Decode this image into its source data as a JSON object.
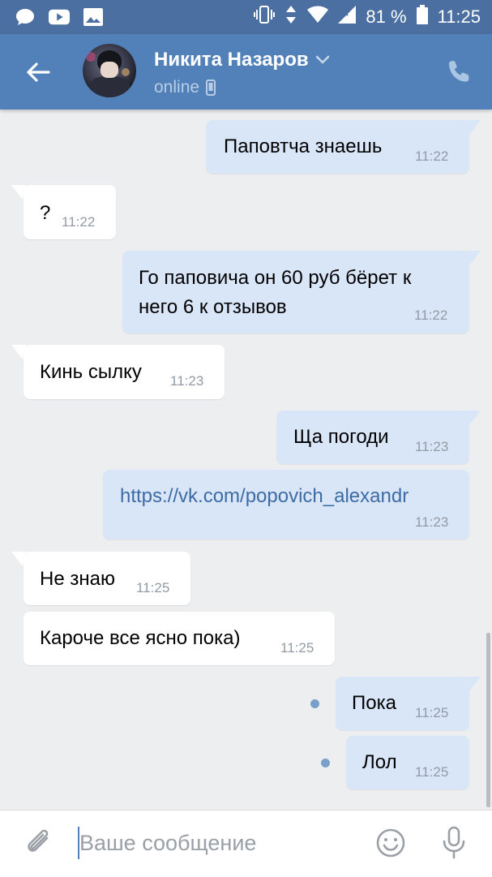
{
  "status_bar": {
    "battery_percent": "81 %",
    "time": "11:25",
    "icons_left": [
      "message-icon",
      "youtube-icon",
      "gallery-icon"
    ],
    "icons_right": [
      "vibrate-icon",
      "data-arrows-icon",
      "wifi-icon",
      "signal-icon",
      "battery-icon"
    ]
  },
  "header": {
    "contact_name": "Никита Назаров",
    "status": "online",
    "back_icon": "arrow-left-icon",
    "call_icon": "phone-icon",
    "colors": {
      "header": "#5181b8",
      "status_bar": "#4a6fa0"
    }
  },
  "messages": [
    {
      "direction": "out",
      "text": "Паповтча знаешь",
      "time": "11:22"
    },
    {
      "direction": "in",
      "text": "?",
      "time": "11:22"
    },
    {
      "direction": "out",
      "text_lines": [
        "Го паповича он 60 руб бёрет  к",
        "него 6 к отзывов"
      ],
      "time": "11:22"
    },
    {
      "direction": "in",
      "text": "Кинь сылку",
      "time": "11:23"
    },
    {
      "direction": "out",
      "text": "Ща погоди",
      "time": "11:23"
    },
    {
      "direction": "out",
      "text": "https://vk.com/popovich_alexandr",
      "time": "11:23",
      "is_link": true
    },
    {
      "direction": "in",
      "text": "Не знаю",
      "time": "11:25"
    },
    {
      "direction": "in",
      "text": "Кароче все ясно пока)",
      "time": "11:25"
    },
    {
      "direction": "out",
      "text": "Пока",
      "time": "11:25",
      "unread": true
    },
    {
      "direction": "out",
      "text": "Лол",
      "time": "11:25",
      "unread": true
    }
  ],
  "input": {
    "placeholder": "Ваше сообщение",
    "value": ""
  }
}
